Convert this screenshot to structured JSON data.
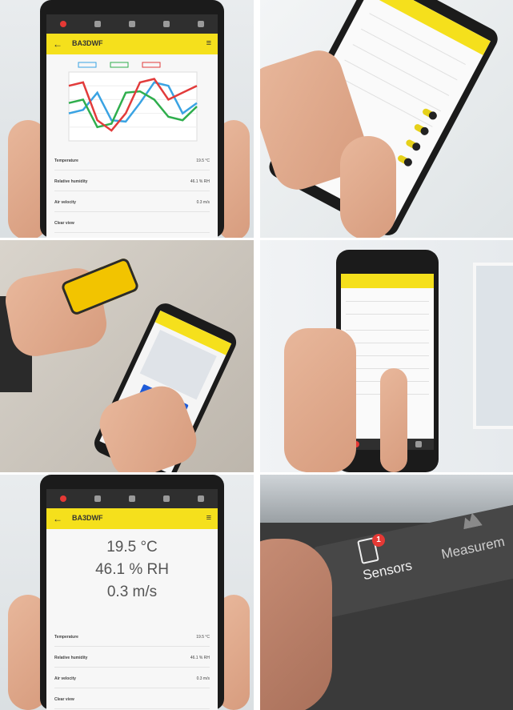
{
  "panel1": {
    "device_name": "BA3DWF",
    "rows": [
      {
        "label": "Temperature",
        "value": "19.5 °C"
      },
      {
        "label": "Relative humidity",
        "value": "46.1 % RH"
      },
      {
        "label": "Air velocity",
        "value": "0.3 m/s"
      },
      {
        "label": "Clear view",
        "value": ""
      }
    ],
    "chart_data": {
      "type": "line",
      "series": [
        {
          "color": "#3aa3e3",
          "values": [
            40,
            45,
            70,
            30,
            28,
            55,
            85,
            80,
            40,
            55
          ]
        },
        {
          "color": "#2fae4d",
          "values": [
            55,
            60,
            20,
            25,
            70,
            72,
            60,
            35,
            30,
            50
          ]
        },
        {
          "color": "#e23b3b",
          "values": [
            80,
            85,
            30,
            15,
            40,
            85,
            90,
            60,
            70,
            80
          ]
        }
      ]
    }
  },
  "panel5": {
    "device_name": "BA3DWF",
    "temperature": "19.5 °C",
    "humidity": "46.1 % RH",
    "air_velocity": "0.3 m/s",
    "rows": [
      {
        "label": "Temperature",
        "value": "19.5 °C"
      },
      {
        "label": "Relative humidity",
        "value": "46.1 % RH"
      },
      {
        "label": "Air velocity",
        "value": "0.3 m/s"
      },
      {
        "label": "Clear view",
        "value": ""
      }
    ]
  },
  "panel6": {
    "sensors_label": "Sensors",
    "measurement_label": "Measurem",
    "badge_count": "1"
  },
  "colors": {
    "accent_yellow": "#f5e01c",
    "nav_dark": "#2f2f2f",
    "alert_red": "#e53935",
    "button_blue": "#1e5bd8"
  }
}
